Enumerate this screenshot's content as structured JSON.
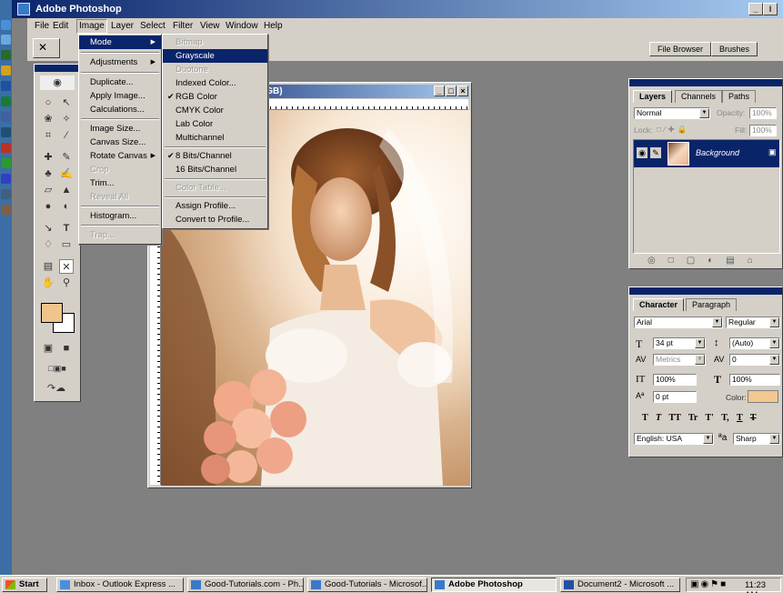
{
  "app": {
    "title": "Adobe Photoshop",
    "controls": [
      "_",
      "ǀ",
      "×"
    ]
  },
  "menubar": {
    "items": [
      "File",
      "Edit",
      "Image",
      "Layer",
      "Select",
      "Filter",
      "View",
      "Window",
      "Help"
    ],
    "active": "Image"
  },
  "options_bar": {
    "file_browser_label": "File Browser",
    "brushes_label": "Brushes"
  },
  "image_menu": {
    "items": [
      {
        "label": "Mode",
        "submenu": true,
        "highlighted": true
      },
      {
        "label": "Adjustments",
        "submenu": true
      },
      {
        "label": "Duplicate..."
      },
      {
        "label": "Apply Image..."
      },
      {
        "label": "Calculations..."
      },
      {
        "label": "Image Size..."
      },
      {
        "label": "Canvas Size..."
      },
      {
        "label": "Rotate Canvas",
        "submenu": true
      },
      {
        "label": "Crop",
        "disabled": true
      },
      {
        "label": "Trim..."
      },
      {
        "label": "Reveal All",
        "disabled": true
      },
      {
        "label": "Histogram..."
      },
      {
        "label": "Trap...",
        "disabled": true
      }
    ]
  },
  "mode_menu": {
    "items": [
      {
        "label": "Bitmap",
        "disabled": true
      },
      {
        "label": "Grayscale",
        "highlighted": true
      },
      {
        "label": "Duotone",
        "disabled": true
      },
      {
        "label": "Indexed Color..."
      },
      {
        "label": "RGB Color",
        "checked": true
      },
      {
        "label": "CMYK Color"
      },
      {
        "label": "Lab Color"
      },
      {
        "label": "Multichannel"
      },
      {
        "label": "8 Bits/Channel",
        "checked": true
      },
      {
        "label": "16 Bits/Channel"
      },
      {
        "label": "Color Table...",
        "disabled": true
      },
      {
        "label": "Assign Profile..."
      },
      {
        "label": "Convert to Profile..."
      }
    ]
  },
  "document": {
    "title_fragment": "RGB)",
    "controls": [
      "_",
      "□",
      "×"
    ]
  },
  "layers_palette": {
    "tabs": [
      "Layers",
      "Channels",
      "Paths"
    ],
    "blend_mode": "Normal",
    "opacity_label": "Opacity:",
    "opacity_value": "100%",
    "lock_label": "Lock:",
    "fill_label": "Fill:",
    "fill_value": "100%",
    "layer_name": "Background"
  },
  "character_palette": {
    "tabs": [
      "Character",
      "Paragraph"
    ],
    "font_family": "Arial",
    "font_style": "Regular",
    "font_size": "34 pt",
    "leading": "(Auto)",
    "kerning": "Metrics",
    "tracking": "0",
    "vertical_scale": "100%",
    "horizontal_scale": "100%",
    "baseline_shift": "0 pt",
    "color_label": "Color:",
    "color_swatch": "#f3c88e",
    "style_buttons": [
      "T",
      "T",
      "TT",
      "Tr",
      "T'",
      "T,",
      "T",
      "T"
    ],
    "language": "English: USA",
    "aa_label": "a",
    "antialias": "Sharp"
  },
  "toolbox": {
    "foreground_color": "#f0c48a",
    "background_color": "#ffffff"
  },
  "taskbar": {
    "start_label": "Start",
    "tasks": [
      {
        "label": "Inbox - Outlook Express ...",
        "active": false
      },
      {
        "label": "Good-Tutorials.com - Ph...",
        "active": false
      },
      {
        "label": "Good-Tutorials - Microsof...",
        "active": false
      },
      {
        "label": "Adobe Photoshop",
        "active": true
      },
      {
        "label": "Document2 - Microsoft ...",
        "active": false
      }
    ],
    "clock": "11:23 AM"
  }
}
